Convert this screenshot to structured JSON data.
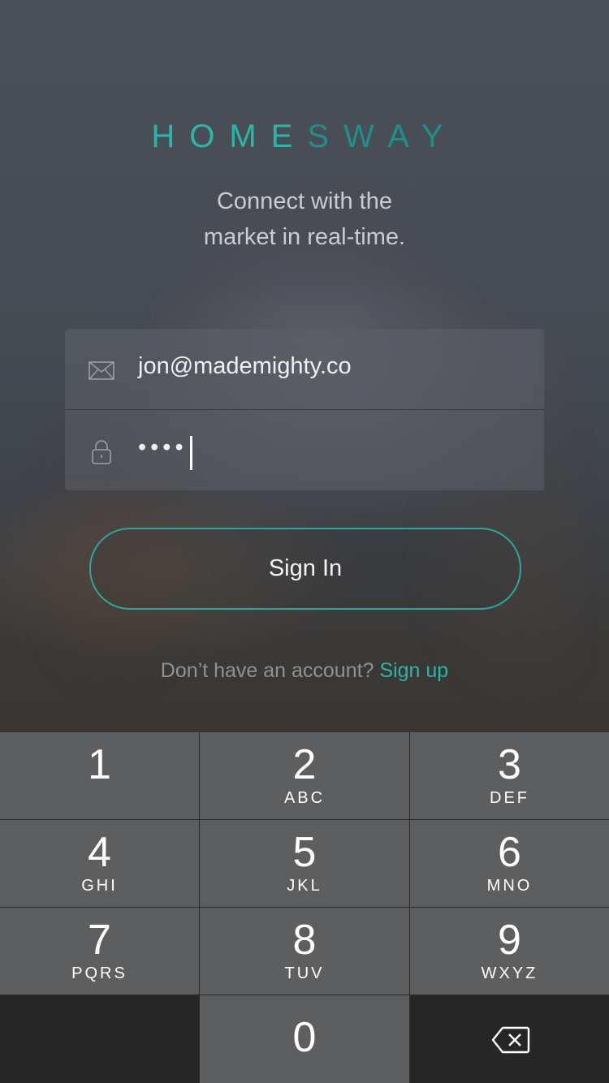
{
  "brand": {
    "part1": "HOME",
    "part2": "SWAY"
  },
  "tagline": {
    "line1": "Connect with the",
    "line2": "market in real-time."
  },
  "form": {
    "email": {
      "value": "jon@mademighty.co",
      "icon": "mail-icon"
    },
    "password": {
      "masked_value": "••••",
      "icon": "lock-icon"
    }
  },
  "sign_in_label": "Sign In",
  "signup": {
    "prompt": "Don’t have an account?",
    "link": "Sign up"
  },
  "keypad": {
    "keys": [
      {
        "digit": "1",
        "letters": ""
      },
      {
        "digit": "2",
        "letters": "ABC"
      },
      {
        "digit": "3",
        "letters": "DEF"
      },
      {
        "digit": "4",
        "letters": "GHI"
      },
      {
        "digit": "5",
        "letters": "JKL"
      },
      {
        "digit": "6",
        "letters": "MNO"
      },
      {
        "digit": "7",
        "letters": "PQRS"
      },
      {
        "digit": "8",
        "letters": "TUV"
      },
      {
        "digit": "9",
        "letters": "WXYZ"
      }
    ],
    "zero": "0",
    "backspace_icon": "backspace-icon"
  },
  "colors": {
    "accent": "#2bb5aa",
    "accent_dark": "#1f8f89",
    "key_bg": "#5d5e5f"
  }
}
